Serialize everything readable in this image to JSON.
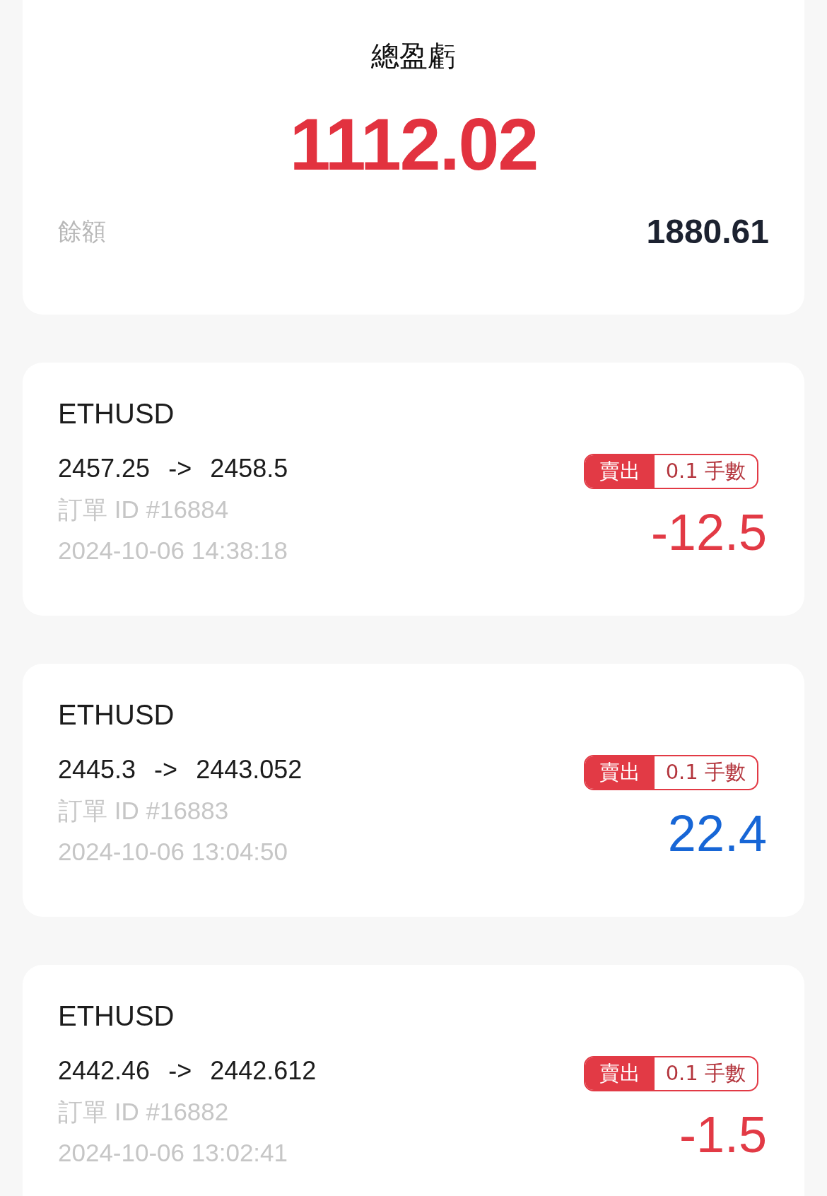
{
  "summary": {
    "title": "總盈虧",
    "total": "1112.02",
    "balance_label": "餘額",
    "balance": "1880.61"
  },
  "trades": [
    {
      "symbol": "ETHUSD",
      "open_price": "2457.25",
      "arrow": "->",
      "close_price": "2458.5",
      "order_id": "訂單 ID #16884",
      "time": "2024-10-06 14:38:18",
      "side": "賣出",
      "lots": "0.1 手數",
      "pnl": "-12.5",
      "color": "#e23a45"
    },
    {
      "symbol": "ETHUSD",
      "open_price": "2445.3",
      "arrow": "->",
      "close_price": "2443.052",
      "order_id": "訂單 ID #16883",
      "time": "2024-10-06 13:04:50",
      "side": "賣出",
      "lots": "0.1 手數",
      "pnl": "22.4",
      "color": "#1766d6"
    },
    {
      "symbol": "ETHUSD",
      "open_price": "2442.46",
      "arrow": "->",
      "close_price": "2442.612",
      "order_id": "訂單 ID #16882",
      "time": "2024-10-06 13:02:41",
      "side": "賣出",
      "lots": "0.1 手數",
      "pnl": "-1.5",
      "color": "#e23a45"
    }
  ]
}
